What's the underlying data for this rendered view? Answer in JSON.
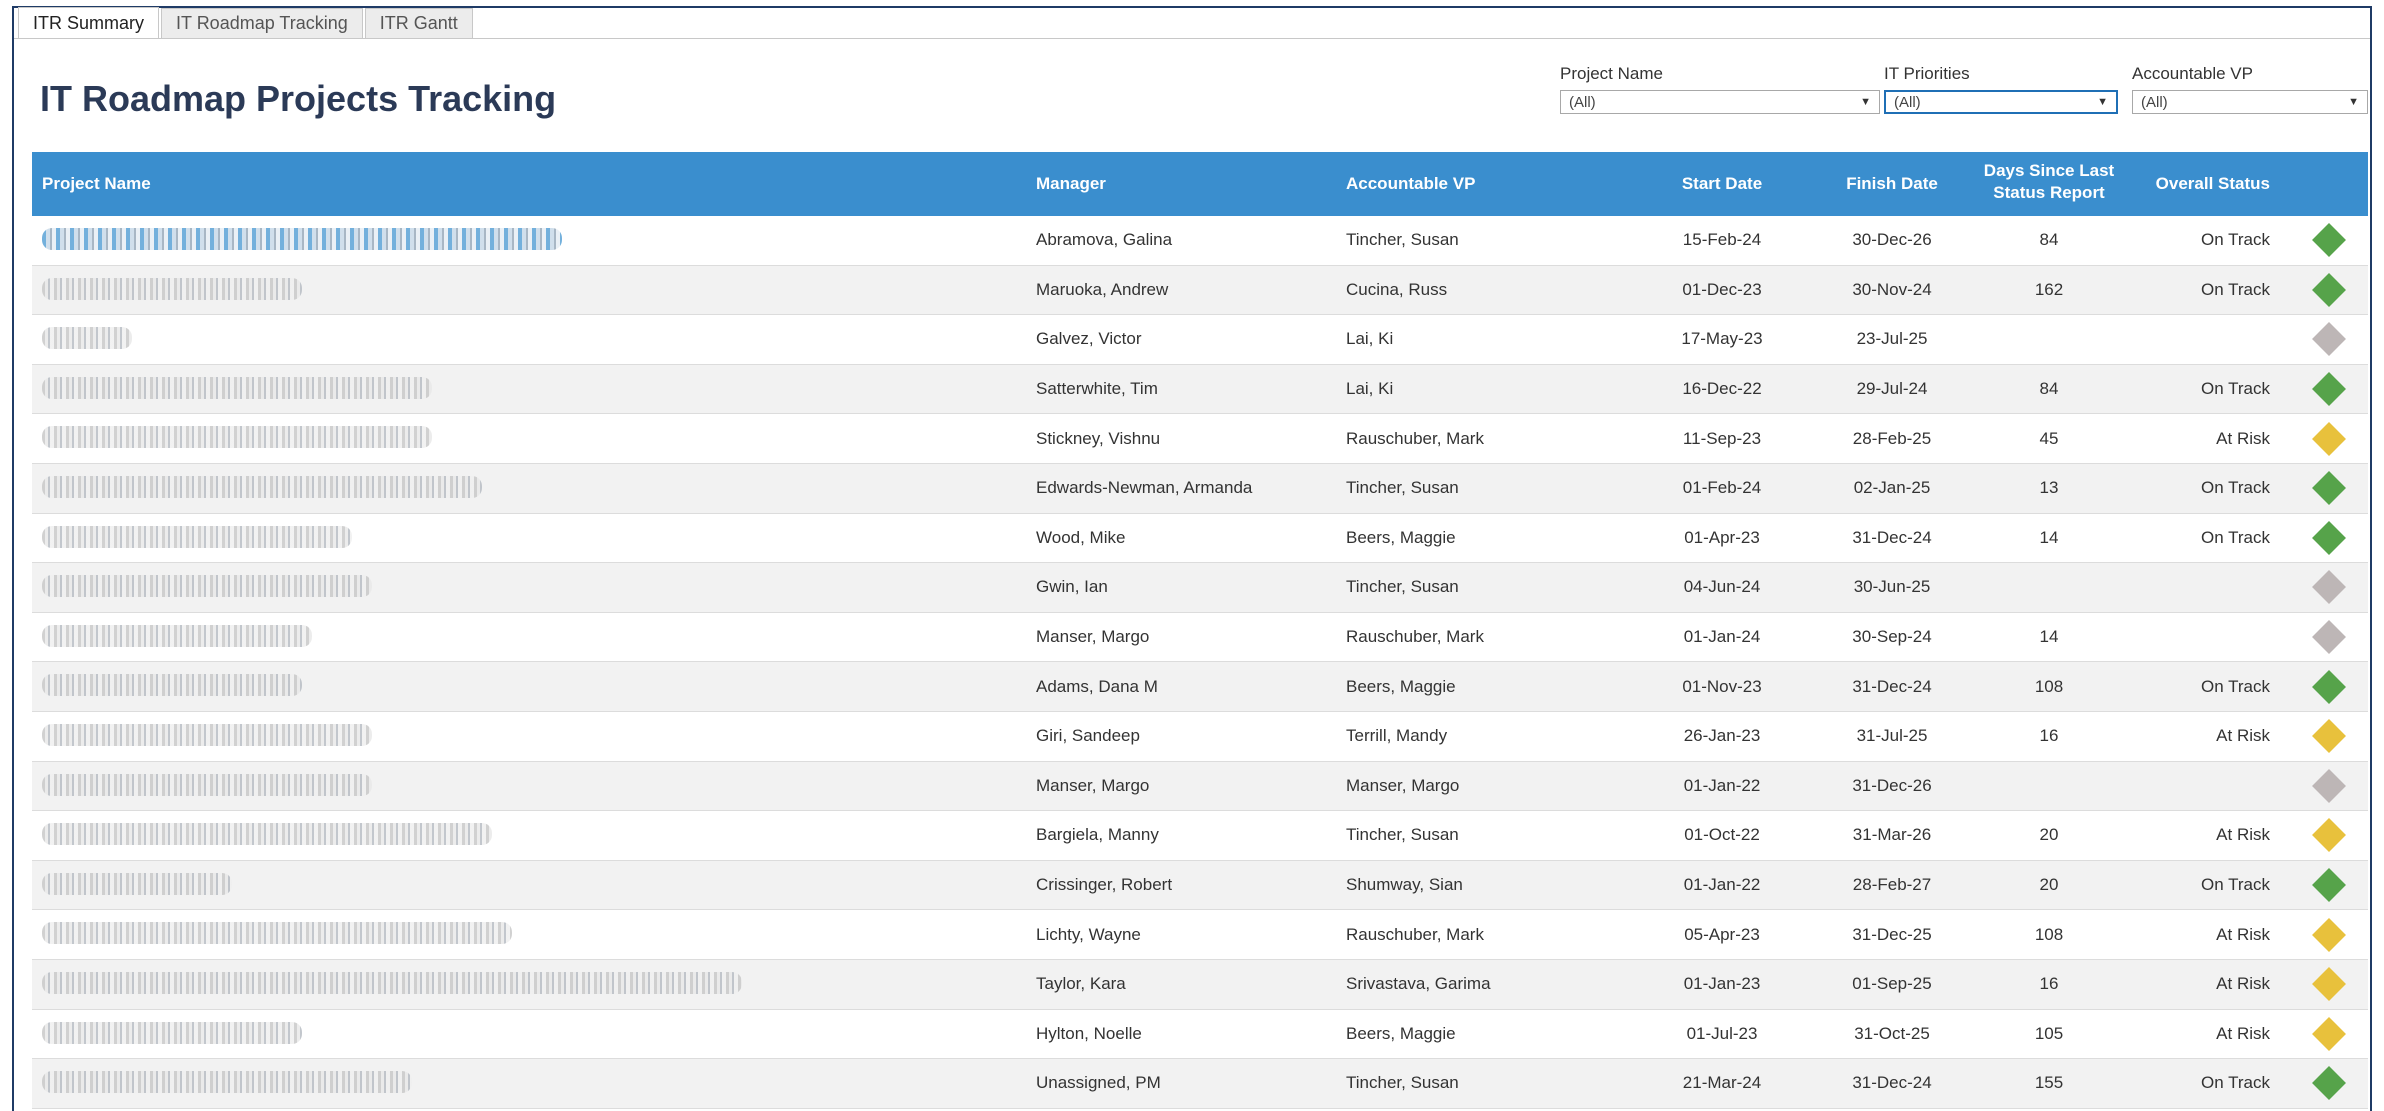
{
  "tabs": [
    {
      "label": "ITR Summary",
      "active": true
    },
    {
      "label": "IT Roadmap Tracking",
      "active": false
    },
    {
      "label": "ITR Gantt",
      "active": false
    }
  ],
  "page_title": "IT Roadmap Projects Tracking",
  "filters": [
    {
      "label": "Project Name",
      "value": "(All)"
    },
    {
      "label": "IT Priorities",
      "value": "(All)"
    },
    {
      "label": "Accountable VP",
      "value": "(All)"
    }
  ],
  "columns": {
    "project_name": "Project Name",
    "manager": "Manager",
    "accountable_vp": "Accountable VP",
    "start_date": "Start Date",
    "finish_date": "Finish Date",
    "days_since_line1": "Days Since Last",
    "days_since_line2": "Status Report",
    "overall_status": "Overall Status"
  },
  "status_colors": {
    "on_track": "#56a34a",
    "at_risk": "#e8c13c",
    "none": "#bdb6b6"
  },
  "rows": [
    {
      "manager": "Abramova, Galina",
      "vp": "Tincher, Susan",
      "start": "15-Feb-24",
      "finish": "30-Dec-26",
      "days": "84",
      "status": "On Track",
      "indicator": "on_track"
    },
    {
      "manager": "Maruoka, Andrew",
      "vp": "Cucina, Russ",
      "start": "01-Dec-23",
      "finish": "30-Nov-24",
      "days": "162",
      "status": "On Track",
      "indicator": "on_track"
    },
    {
      "manager": "Galvez, Victor",
      "vp": "Lai, Ki",
      "start": "17-May-23",
      "finish": "23-Jul-25",
      "days": "",
      "status": "",
      "indicator": "none"
    },
    {
      "manager": "Satterwhite, Tim",
      "vp": "Lai, Ki",
      "start": "16-Dec-22",
      "finish": "29-Jul-24",
      "days": "84",
      "status": "On Track",
      "indicator": "on_track"
    },
    {
      "manager": "Stickney, Vishnu",
      "vp": "Rauschuber, Mark",
      "start": "11-Sep-23",
      "finish": "28-Feb-25",
      "days": "45",
      "status": "At Risk",
      "indicator": "at_risk"
    },
    {
      "manager": "Edwards-Newman, Armanda",
      "vp": "Tincher, Susan",
      "start": "01-Feb-24",
      "finish": "02-Jan-25",
      "days": "13",
      "status": "On Track",
      "indicator": "on_track"
    },
    {
      "manager": "Wood, Mike",
      "vp": "Beers, Maggie",
      "start": "01-Apr-23",
      "finish": "31-Dec-24",
      "days": "14",
      "status": "On Track",
      "indicator": "on_track"
    },
    {
      "manager": "Gwin, Ian",
      "vp": "Tincher, Susan",
      "start": "04-Jun-24",
      "finish": "30-Jun-25",
      "days": "",
      "status": "",
      "indicator": "none"
    },
    {
      "manager": "Manser, Margo",
      "vp": "Rauschuber, Mark",
      "start": "01-Jan-24",
      "finish": "30-Sep-24",
      "days": "14",
      "status": "",
      "indicator": "none"
    },
    {
      "manager": "Adams, Dana M",
      "vp": "Beers, Maggie",
      "start": "01-Nov-23",
      "finish": "31-Dec-24",
      "days": "108",
      "status": "On Track",
      "indicator": "on_track"
    },
    {
      "manager": "Giri, Sandeep",
      "vp": "Terrill, Mandy",
      "start": "26-Jan-23",
      "finish": "31-Jul-25",
      "days": "16",
      "status": "At Risk",
      "indicator": "at_risk"
    },
    {
      "manager": "Manser, Margo",
      "vp": "Manser, Margo",
      "start": "01-Jan-22",
      "finish": "31-Dec-26",
      "days": "",
      "status": "",
      "indicator": "none"
    },
    {
      "manager": "Bargiela, Manny",
      "vp": "Tincher, Susan",
      "start": "01-Oct-22",
      "finish": "31-Mar-26",
      "days": "20",
      "status": "At Risk",
      "indicator": "at_risk"
    },
    {
      "manager": "Crissinger, Robert",
      "vp": "Shumway, Sian",
      "start": "01-Jan-22",
      "finish": "28-Feb-27",
      "days": "20",
      "status": "On Track",
      "indicator": "on_track"
    },
    {
      "manager": "Lichty, Wayne",
      "vp": "Rauschuber, Mark",
      "start": "05-Apr-23",
      "finish": "31-Dec-25",
      "days": "108",
      "status": "At Risk",
      "indicator": "at_risk"
    },
    {
      "manager": "Taylor, Kara",
      "vp": "Srivastava, Garima",
      "start": "01-Jan-23",
      "finish": "01-Sep-25",
      "days": "16",
      "status": "At Risk",
      "indicator": "at_risk"
    },
    {
      "manager": "Hylton, Noelle",
      "vp": "Beers, Maggie",
      "start": "01-Jul-23",
      "finish": "31-Oct-25",
      "days": "105",
      "status": "At Risk",
      "indicator": "at_risk"
    },
    {
      "manager": "Unassigned, PM",
      "vp": "Tincher, Susan",
      "start": "21-Mar-24",
      "finish": "31-Dec-24",
      "days": "155",
      "status": "On Track",
      "indicator": "on_track"
    }
  ]
}
